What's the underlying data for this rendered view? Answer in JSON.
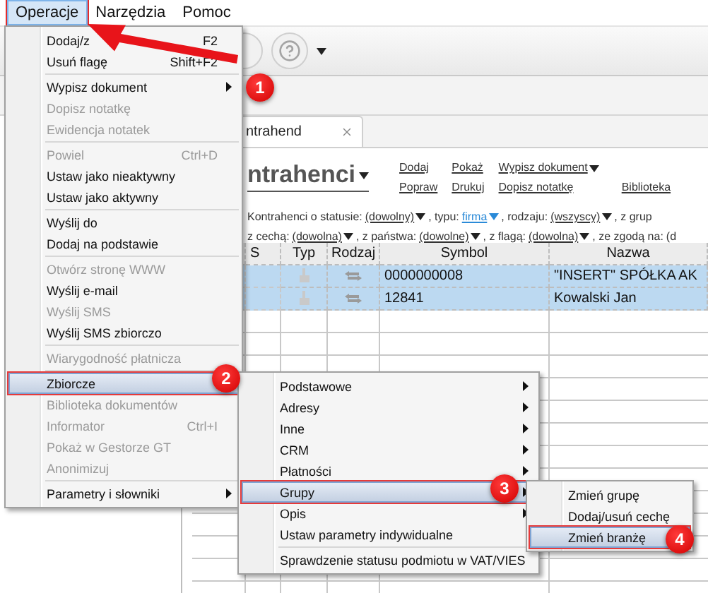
{
  "menu_bar": [
    {
      "label": "Operacje",
      "selected": true
    },
    {
      "label": "Narzędzia",
      "selected": false
    },
    {
      "label": "Pomoc",
      "selected": false
    }
  ],
  "document_tab": {
    "label": "ntrahend"
  },
  "heading": "ntrahenci",
  "action_columns": [
    [
      {
        "label": "Dodaj",
        "dropdown": false
      },
      {
        "label": "Popraw",
        "dropdown": false
      }
    ],
    [
      {
        "label": "Pokaż",
        "dropdown": false
      },
      {
        "label": "Drukuj",
        "dropdown": false
      }
    ],
    [
      {
        "label": "Wypisz dokument",
        "dropdown": true
      },
      {
        "label": "Dopisz notatkę",
        "dropdown": false
      }
    ],
    [
      {
        "label": "Biblioteka",
        "dropdown": false
      }
    ]
  ],
  "filters": [
    [
      {
        "kind": "label",
        "text": "Kontrahenci o statusie:"
      },
      {
        "kind": "choice",
        "text": "(dowolny)",
        "active": false
      },
      {
        "kind": "label",
        "text": ", typu:"
      },
      {
        "kind": "choice",
        "text": "firma",
        "active": true
      },
      {
        "kind": "label",
        "text": ", rodzaju:"
      },
      {
        "kind": "choice",
        "text": "(wszyscy)",
        "active": false
      },
      {
        "kind": "label",
        "text": ", z grup"
      }
    ],
    [
      {
        "kind": "label",
        "text": "z cechą:"
      },
      {
        "kind": "choice",
        "text": "(dowolna)",
        "active": false
      },
      {
        "kind": "label",
        "text": ", z państwa:"
      },
      {
        "kind": "choice",
        "text": "(dowolne)",
        "active": false
      },
      {
        "kind": "label",
        "text": ", z flagą:"
      },
      {
        "kind": "choice",
        "text": "(dowolna)",
        "active": false
      },
      {
        "kind": "label",
        "text": ", ze zgodą na:"
      },
      {
        "kind": "label",
        "text": "(d"
      }
    ]
  ],
  "table": {
    "columns": [
      "S",
      "Typ",
      "Rodzaj",
      "Symbol",
      "Nazwa"
    ],
    "rows": [
      {
        "symbol": "0000000008",
        "name": "\"INSERT\" SPÓŁKA AK",
        "selected": true
      },
      {
        "symbol": "12841",
        "name": "Kowalski Jan",
        "selected": true
      }
    ]
  },
  "operacje_menu": {
    "items": [
      {
        "kind": "item",
        "label": "Dodaj/z",
        "shortcut": "F2",
        "disabled": false,
        "selected": false,
        "has_submenu": false
      },
      {
        "kind": "item",
        "label": "Usuń flagę",
        "shortcut": "Shift+F2",
        "disabled": false,
        "selected": false,
        "has_submenu": false
      },
      {
        "kind": "separator"
      },
      {
        "kind": "item",
        "label": "Wypisz dokument",
        "disabled": false,
        "selected": false,
        "has_submenu": true
      },
      {
        "kind": "item",
        "label": "Dopisz notatkę",
        "disabled": true,
        "selected": false,
        "has_submenu": false
      },
      {
        "kind": "item",
        "label": "Ewidencja notatek",
        "disabled": true,
        "selected": false,
        "has_submenu": false
      },
      {
        "kind": "separator"
      },
      {
        "kind": "item",
        "label": "Powiel",
        "shortcut": "Ctrl+D",
        "disabled": true,
        "selected": false,
        "has_submenu": false
      },
      {
        "kind": "item",
        "label": "Ustaw jako nieaktywny",
        "disabled": false,
        "selected": false,
        "has_submenu": false
      },
      {
        "kind": "item",
        "label": "Ustaw jako aktywny",
        "disabled": false,
        "selected": false,
        "has_submenu": false
      },
      {
        "kind": "separator"
      },
      {
        "kind": "item",
        "label": "Wyślij do",
        "disabled": false,
        "selected": false,
        "has_submenu": false
      },
      {
        "kind": "item",
        "label": "Dodaj na podstawie",
        "disabled": false,
        "selected": false,
        "has_submenu": false
      },
      {
        "kind": "separator"
      },
      {
        "kind": "item",
        "label": "Otwórz stronę WWW",
        "disabled": true,
        "selected": false,
        "has_submenu": false
      },
      {
        "kind": "item",
        "label": "Wyślij e-mail",
        "disabled": false,
        "selected": false,
        "has_submenu": false
      },
      {
        "kind": "item",
        "label": "Wyślij SMS",
        "disabled": true,
        "selected": false,
        "has_submenu": false
      },
      {
        "kind": "item",
        "label": "Wyślij SMS zbiorczo",
        "disabled": false,
        "selected": false,
        "has_submenu": false
      },
      {
        "kind": "separator"
      },
      {
        "kind": "item",
        "label": "Wiarygodność płatnicza",
        "disabled": true,
        "selected": false,
        "has_submenu": false
      },
      {
        "kind": "separator"
      },
      {
        "kind": "item",
        "label": "Zbiorcze",
        "disabled": false,
        "selected": true,
        "has_submenu": true,
        "children": [
          {
            "kind": "item",
            "label": "Podstawowe",
            "disabled": false,
            "selected": false,
            "has_submenu": true
          },
          {
            "kind": "item",
            "label": "Adresy",
            "disabled": false,
            "selected": false,
            "has_submenu": true
          },
          {
            "kind": "item",
            "label": "Inne",
            "disabled": false,
            "selected": false,
            "has_submenu": true
          },
          {
            "kind": "item",
            "label": "CRM",
            "disabled": false,
            "selected": false,
            "has_submenu": true
          },
          {
            "kind": "item",
            "label": "Płatności",
            "disabled": false,
            "selected": false,
            "has_submenu": true
          },
          {
            "kind": "item",
            "label": "Grupy",
            "disabled": false,
            "selected": true,
            "has_submenu": true,
            "children": [
              {
                "kind": "item",
                "label": "Zmień grupę",
                "disabled": false,
                "selected": false,
                "has_submenu": false
              },
              {
                "kind": "item",
                "label": "Dodaj/usuń cechę",
                "disabled": false,
                "selected": false,
                "has_submenu": false
              },
              {
                "kind": "item",
                "label": "Zmień branżę",
                "disabled": false,
                "selected": true,
                "has_submenu": false
              }
            ]
          },
          {
            "kind": "item",
            "label": "Opis",
            "disabled": false,
            "selected": false,
            "has_submenu": true
          },
          {
            "kind": "item",
            "label": "Ustaw parametry indywidualne",
            "disabled": false,
            "selected": false,
            "has_submenu": false
          },
          {
            "kind": "separator"
          },
          {
            "kind": "item",
            "label": "Sprawdzenie statusu podmiotu w VAT/VIES",
            "disabled": false,
            "selected": false,
            "has_submenu": false
          }
        ]
      },
      {
        "kind": "item",
        "label": "Biblioteka dokumentów",
        "disabled": true,
        "selected": false,
        "has_submenu": false
      },
      {
        "kind": "item",
        "label": "Informator",
        "shortcut": "Ctrl+I",
        "disabled": true,
        "selected": false,
        "has_submenu": false
      },
      {
        "kind": "item",
        "label": "Pokaż w Gestorze GT",
        "disabled": true,
        "selected": false,
        "has_submenu": false
      },
      {
        "kind": "item",
        "label": "Anonimizuj",
        "disabled": true,
        "selected": false,
        "has_submenu": false
      },
      {
        "kind": "separator"
      },
      {
        "kind": "item",
        "label": "Parametry i słowniki",
        "disabled": false,
        "selected": false,
        "has_submenu": true
      }
    ]
  },
  "callouts": [
    "1",
    "2",
    "3",
    "4"
  ]
}
